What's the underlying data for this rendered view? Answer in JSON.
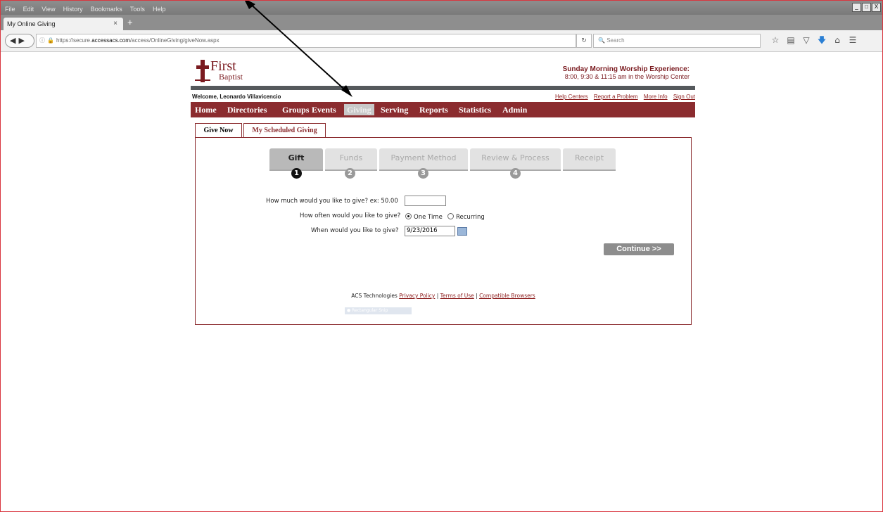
{
  "menubar": {
    "items": [
      "File",
      "Edit",
      "View",
      "History",
      "Bookmarks",
      "Tools",
      "Help"
    ]
  },
  "window_controls": [
    "_",
    "□",
    "X"
  ],
  "tab": {
    "title": "My Online Giving",
    "close": "×",
    "new_tab": "+"
  },
  "url": {
    "prefix": "https://secure.",
    "domain": "accessacs.com",
    "path": "/access/OnlineGiving/giveNow.aspx"
  },
  "search": {
    "placeholder": "Search"
  },
  "header": {
    "logo_first": "First",
    "logo_baptist": "Baptist",
    "worship_title": "Sunday Morning Worship Experience:",
    "worship_times": "8:00, 9:30 & 11:15 am in the Worship Center"
  },
  "welcome": "Welcome, Leonardo Villavicencio",
  "top_links": [
    "Help Centers",
    "Report a Problem",
    "More Info",
    "Sign Out"
  ],
  "nav": [
    "Home",
    "Directories",
    "Groups",
    "Events",
    "Giving",
    "Serving",
    "Reports",
    "Statistics",
    "Admin"
  ],
  "nav_active": "Giving",
  "subtabs": [
    "Give Now",
    "My Scheduled Giving"
  ],
  "steps": [
    {
      "label": "Gift",
      "num": "1"
    },
    {
      "label": "Funds",
      "num": "2"
    },
    {
      "label": "Payment Method",
      "num": "3"
    },
    {
      "label": "Review & Process",
      "num": "4"
    },
    {
      "label": "Receipt",
      "num": ""
    }
  ],
  "form": {
    "amount_label": "How much would you like to give? ex: 50.00",
    "amount_value": "",
    "often_label": "How often would you like to give?",
    "opt_one_time": "One Time",
    "opt_recurring": "Recurring",
    "when_label": "When would you like to give?",
    "when_value": "9/23/2016"
  },
  "continue_label": "Continue >>",
  "footer": {
    "company": "ACS Technologies",
    "privacy": "Privacy Policy",
    "terms": "Terms of Use",
    "browsers": "Compatible Browsers"
  },
  "snip_label": "Rectangular Snip",
  "colors": {
    "brand": "#8b2c2f",
    "border": "#d9363e"
  }
}
